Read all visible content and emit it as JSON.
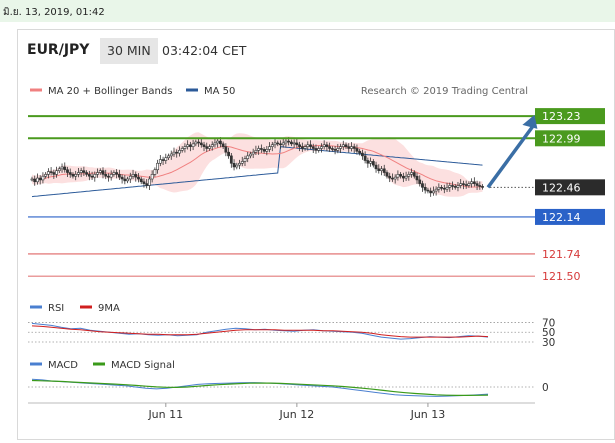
{
  "timestamp": "มิ.ย. 13, 2019, 01:42",
  "header": {
    "pair": "EUR/JPY",
    "timeframe": "30 MIN",
    "time": "03:42:04 CET"
  },
  "colors": {
    "ma20": "#f08080",
    "ma50": "#2b5a99",
    "resistance": "#4a9a1e",
    "support": "#2a62c8",
    "target": "#d63a3a",
    "candle": "#333333",
    "band_fill": "#fce0e0",
    "rsi": "#4a7fd0",
    "rsi_ma": "#d01f1f",
    "macd": "#4a7fd0",
    "macd_signal": "#3a9a1a",
    "arrow": "#3a6ea5"
  },
  "chart_data": [
    {
      "type": "line",
      "title": "",
      "legend": [
        {
          "name": "MA 20 + Bollinger Bands",
          "color": "#f08080"
        },
        {
          "name": "MA 50",
          "color": "#2b5a99"
        }
      ],
      "attribution": "Research © 2019 Trading Central",
      "x_labels": [
        {
          "label": "Jun 11",
          "x": 49
        },
        {
          "label": "Jun 12",
          "x": 97
        },
        {
          "label": "Jun 13",
          "x": 145
        }
      ],
      "x_range": [
        0,
        167
      ],
      "y_range": [
        121.35,
        123.35
      ],
      "close": [
        122.55,
        122.52,
        122.56,
        122.54,
        122.58,
        122.6,
        122.63,
        122.62,
        122.6,
        122.64,
        122.66,
        122.68,
        122.65,
        122.62,
        122.6,
        122.58,
        122.6,
        122.62,
        122.64,
        122.62,
        122.6,
        122.58,
        122.57,
        122.6,
        122.62,
        122.64,
        122.6,
        122.58,
        122.57,
        122.6,
        122.62,
        122.6,
        122.57,
        122.55,
        122.53,
        122.55,
        122.58,
        122.6,
        122.57,
        122.55,
        122.52,
        122.5,
        122.48,
        122.55,
        122.6,
        122.65,
        122.72,
        122.76,
        122.75,
        122.78,
        122.8,
        122.82,
        122.84,
        122.83,
        122.86,
        122.88,
        122.9,
        122.92,
        122.9,
        122.93,
        122.95,
        122.94,
        122.92,
        122.9,
        122.88,
        122.9,
        122.92,
        122.94,
        122.96,
        122.93,
        122.9,
        122.84,
        122.8,
        122.72,
        122.68,
        122.7,
        122.72,
        122.74,
        122.77,
        122.8,
        122.82,
        122.84,
        122.86,
        122.88,
        122.87,
        122.85,
        122.87,
        122.9,
        122.92,
        122.94,
        122.93,
        122.92,
        122.94,
        122.96,
        122.95,
        122.93,
        122.94,
        122.92,
        122.9,
        122.88,
        122.9,
        122.92,
        122.9,
        122.88,
        122.86,
        122.88,
        122.9,
        122.92,
        122.9,
        122.88,
        122.87,
        122.86,
        122.88,
        122.9,
        122.92,
        122.9,
        122.88,
        122.9,
        122.88,
        122.85,
        122.83,
        122.8,
        122.75,
        122.72,
        122.74,
        122.7,
        122.66,
        122.64,
        122.66,
        122.62,
        122.58,
        122.56,
        122.55,
        122.57,
        122.6,
        122.58,
        122.56,
        122.58,
        122.6,
        122.62,
        122.58,
        122.54,
        122.5,
        122.46,
        122.43,
        122.42,
        122.4,
        122.42,
        122.44,
        122.46,
        122.45,
        122.44,
        122.46,
        122.48,
        122.47,
        122.46,
        122.48,
        122.5,
        122.49,
        122.48,
        122.5,
        122.52,
        122.5,
        122.48,
        122.47,
        122.46
      ],
      "ma50_start": 122.36,
      "ma50_end": 122.62,
      "levels": [
        {
          "value": 123.23,
          "label": "123.23",
          "kind": "resistance"
        },
        {
          "value": 122.99,
          "label": "122.99",
          "kind": "resistance"
        },
        {
          "value": 122.46,
          "label": "122.46",
          "kind": "current"
        },
        {
          "value": 122.14,
          "label": "122.14",
          "kind": "support"
        },
        {
          "value": 121.74,
          "label": "121.74",
          "kind": "target"
        },
        {
          "value": 121.5,
          "label": "121.50",
          "kind": "target"
        }
      ],
      "forecast_arrow": {
        "from": [
          167,
          122.46
        ],
        "to": [
          184,
          123.2
        ]
      }
    },
    {
      "type": "line",
      "title": "",
      "legend": [
        {
          "name": "RSI",
          "color": "#4a7fd0"
        },
        {
          "name": "9MA",
          "color": "#d01f1f"
        }
      ],
      "y_range": [
        28,
        75
      ],
      "levels": [
        {
          "value": 70,
          "label": "70"
        },
        {
          "value": 50,
          "label": "50"
        },
        {
          "value": 30,
          "label": "30"
        }
      ],
      "rsi": [
        68,
        66,
        64,
        60,
        57,
        58,
        54,
        52,
        50,
        48,
        46,
        47,
        45,
        44,
        45,
        43,
        44,
        45,
        50,
        53,
        56,
        58,
        57,
        55,
        56,
        54,
        53,
        52,
        54,
        55,
        53,
        52,
        51,
        50,
        48,
        44,
        40,
        38,
        36,
        37,
        39,
        41,
        40,
        39,
        41,
        43,
        42,
        40
      ],
      "rsi_ma": [
        63,
        62,
        60,
        58,
        56,
        55,
        53,
        51,
        50,
        49,
        48,
        47,
        46,
        46,
        45,
        45,
        45,
        46,
        48,
        50,
        52,
        54,
        55,
        55,
        55,
        55,
        54,
        54,
        54,
        54,
        53,
        53,
        52,
        51,
        50,
        48,
        45,
        43,
        41,
        40,
        40,
        40,
        40,
        40,
        40,
        41,
        42,
        41
      ]
    },
    {
      "type": "line",
      "title": "",
      "legend": [
        {
          "name": "MACD",
          "color": "#4a7fd0"
        },
        {
          "name": "MACD Signal",
          "color": "#3a9a1a"
        }
      ],
      "y_range": [
        -0.1,
        0.1
      ],
      "levels": [
        {
          "value": 0,
          "label": "0"
        }
      ],
      "macd": [
        0.06,
        0.055,
        0.045,
        0.04,
        0.035,
        0.03,
        0.025,
        0.02,
        0.015,
        0.01,
        0.0,
        -0.01,
        -0.015,
        -0.01,
        0.0,
        0.01,
        0.02,
        0.025,
        0.028,
        0.03,
        0.032,
        0.034,
        0.033,
        0.03,
        0.025,
        0.02,
        0.015,
        0.01,
        0.005,
        0.0,
        -0.01,
        -0.02,
        -0.03,
        -0.04,
        -0.05,
        -0.06,
        -0.065,
        -0.068,
        -0.07,
        -0.072,
        -0.07,
        -0.068,
        -0.065,
        -0.06,
        -0.055
      ],
      "macd_signal": [
        0.05,
        0.048,
        0.045,
        0.042,
        0.038,
        0.034,
        0.03,
        0.026,
        0.022,
        0.018,
        0.012,
        0.006,
        0.001,
        -0.002,
        -0.003,
        0.0,
        0.006,
        0.012,
        0.018,
        0.022,
        0.026,
        0.029,
        0.03,
        0.03,
        0.028,
        0.025,
        0.021,
        0.017,
        0.013,
        0.009,
        0.004,
        -0.003,
        -0.01,
        -0.018,
        -0.027,
        -0.036,
        -0.044,
        -0.05,
        -0.055,
        -0.06,
        -0.063,
        -0.065,
        -0.065,
        -0.064,
        -0.062
      ]
    }
  ]
}
